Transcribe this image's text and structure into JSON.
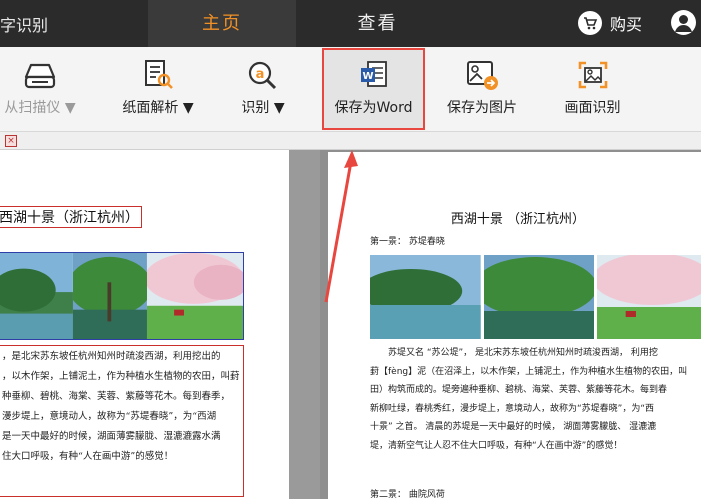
{
  "app": {
    "title": "字识别"
  },
  "tabs": [
    {
      "label": "主页",
      "active": true
    },
    {
      "label": "查看",
      "active": false
    }
  ],
  "header": {
    "buy_label": "购买",
    "user_icon": "user-icon",
    "cart_icon": "cart-icon"
  },
  "toolbar": {
    "items": [
      {
        "label": "从扫描仪 ▼",
        "icon": "scanner-icon",
        "disabled": true
      },
      {
        "label": "纸面解析 ▼",
        "icon": "page-analysis-icon",
        "disabled": false
      },
      {
        "label": "识别 ▼",
        "icon": "recognize-icon",
        "disabled": false
      },
      {
        "label": "保存为Word",
        "icon": "word-icon",
        "disabled": false,
        "highlighted": true
      },
      {
        "label": "保存为图片",
        "icon": "save-image-icon",
        "disabled": false
      },
      {
        "label": "画面识别",
        "icon": "screen-recognize-icon",
        "disabled": false
      }
    ]
  },
  "colors": {
    "accent": "#f29126",
    "highlight": "#e8473f",
    "topbar": "#2b2b2b"
  },
  "left_doc": {
    "title": "西湖十景（浙江杭州）",
    "lines": [
      "，是北宋苏东坡任杭州知州时疏浚西湖，利用挖出的",
      "，以木作架，上铺泥土，作为种植水生植物的农田，叫葑",
      "种垂柳、碧桃、海棠、芙蓉、紫藤等花木。每到春季，",
      "漫步堤上，意境动人，故称为“苏堤春晓”，为“西湖",
      "是一天中最好的时候，湖面薄雾朦胧、湿漉漉露水满",
      "住大口呼吸，有种“人在画中游”的感觉！"
    ]
  },
  "right_doc": {
    "title": "西湖十景 （浙江杭州）",
    "section1": "第一景：  苏堤春晓",
    "lines": [
      "苏堤又名 “苏公堤”， 是北宋苏东坡任杭州知州时疏浚西湖， 利用挖",
      "葑【fèng】泥（在沼泽上，以木作架，上铺泥土，作为种植水生植物的农田，叫",
      "田）构筑而成的。堤旁遍种垂柳、碧桃、海棠、芙蓉、紫藤等花木。每到春",
      "新柳吐绿，春桃秀红，漫步堤上，意境动人，故称为“苏堤春晓”，为“西",
      "十景” 之首。 清晨的苏堤是一天中最好的时候， 湖面薄雾朦胧、 湿漉漉",
      "堤，清新空气让人忍不住大口呼吸，有种“人在画中游”的感觉！"
    ],
    "section2": "第二景：   曲院风荷"
  }
}
